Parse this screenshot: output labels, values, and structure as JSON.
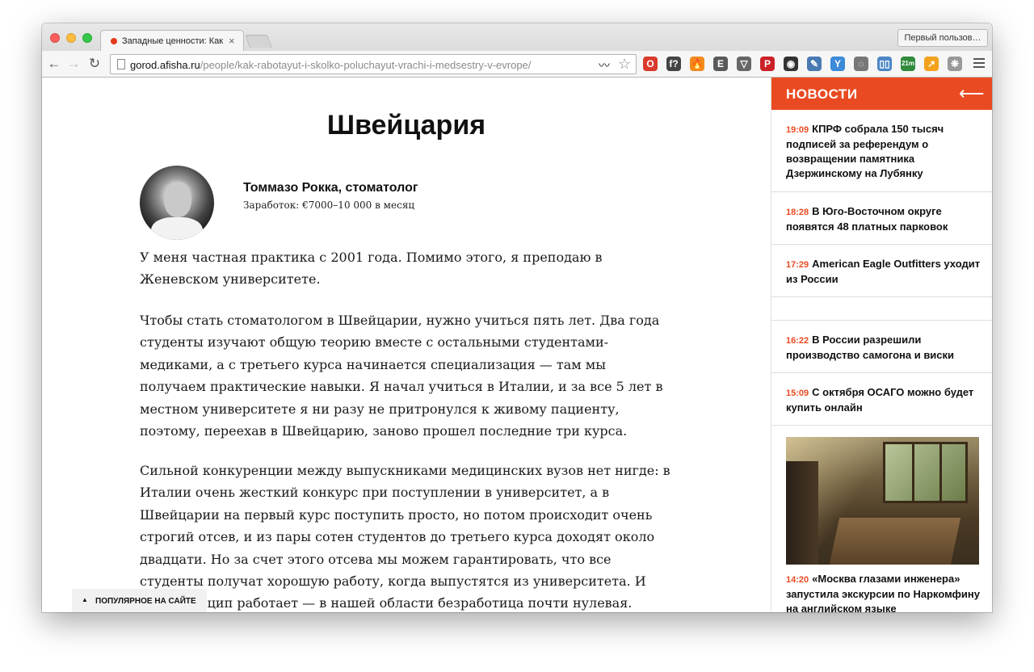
{
  "browser": {
    "tab_title": "Западные ценности: Как р",
    "tab_close": "×",
    "profile_button": "Первый пользов…",
    "url_host": "gorod.afisha.ru",
    "url_path": "/people/kak-rabotayut-i-skolko-poluchayut-vrachi-i-medsestry-v-evrope/",
    "back_icon": "arrow-left",
    "forward_icon": "arrow-right",
    "reload_icon": "reload",
    "star_icon": "star",
    "extensions": [
      {
        "name": "opera-badge-icon",
        "label": "O",
        "color": "#d93a2b"
      },
      {
        "name": "fx-icon",
        "label": "f?",
        "color": "#444444"
      },
      {
        "name": "fire-icon",
        "label": "🔥",
        "color": "#f28a1d"
      },
      {
        "name": "evernote-icon",
        "label": "E",
        "color": "#5a5a5a"
      },
      {
        "name": "pocket-icon",
        "label": "▽",
        "color": "#666666"
      },
      {
        "name": "pinterest-icon",
        "label": "P",
        "color": "#cb2027"
      },
      {
        "name": "camera-icon",
        "label": "◉",
        "color": "#333333"
      },
      {
        "name": "eyedropper-icon",
        "label": "✎",
        "color": "#4a7ab3"
      },
      {
        "name": "y-icon",
        "label": "Y",
        "color": "#3b8bd8"
      },
      {
        "name": "refresh-ext-icon",
        "label": "◌",
        "color": "#777777"
      },
      {
        "name": "book-icon",
        "label": "▯▯",
        "color": "#4b86c6"
      },
      {
        "name": "timer-icon",
        "label": "21m",
        "color": "#2f8a3a"
      },
      {
        "name": "chart-icon",
        "label": "↗",
        "color": "#f2a21d"
      },
      {
        "name": "paw-icon",
        "label": "❋",
        "color": "#999999"
      }
    ]
  },
  "article": {
    "title": "Швейцария",
    "person_name": "Томмазо Рокка, стоматолог",
    "person_salary": "Заработок: €7000–10 000 в месяц",
    "paragraphs": [
      "У меня частная практика с 2001 года. Помимо этого, я преподаю в Женевском университете.",
      "Чтобы стать стоматологом в Швейцарии, нужно учиться пять лет. Два года студенты изучают общую теорию вместе с остальными студентами-медиками, а с третьего курса начинается специализация — там мы получаем практические навыки. Я начал учиться в Италии, и за все 5 лет в местном университете я ни разу не притронулся к живому пациенту, поэтому, переехав в Швейцарию, заново прошел последние три курса.",
      "Сильной конкуренции между выпускниками медицинских вузов нет нигде: в Италии очень жесткий конкурс при поступлении в университет, а в Швейцарии на первый курс поступить просто, но потом происходит очень строгий отсев, и из пары сотен студентов до третьего курса доходят около двадцати. Но за счет этого отсева мы можем гарантировать, что все студенты получат хорошую работу, когда выпустятся из университета. И этот принцип работает — в нашей области безработица почти нулевая. После университета"
    ],
    "popular_label": "ПОПУЛЯРНОЕ НА САЙТЕ",
    "popular_caret": "▲"
  },
  "sidebar": {
    "title": "НОВОСТИ",
    "back_arrow": "⟵",
    "accent_color": "#ea4a21",
    "items": [
      {
        "time": "19:09",
        "text": "КПРФ собрала 150 тысяч подписей за референдум о возвращении памятника Дзержинскому на Лубянку"
      },
      {
        "time": "18:28",
        "text": "В Юго-Восточном округе появятся 48 платных парковок"
      },
      {
        "time": "17:29",
        "text": "American Eagle Outfitters уходит из России"
      },
      {
        "time": "16:22",
        "text": "В России разрешили производство самогона и виски"
      },
      {
        "time": "15:09",
        "text": "С октября ОСАГО можно будет купить онлайн"
      }
    ],
    "photo_item": {
      "time": "14:20",
      "text": "«Москва глазами инженера» запустила экскурсии по Наркомфину на английском языке"
    }
  }
}
